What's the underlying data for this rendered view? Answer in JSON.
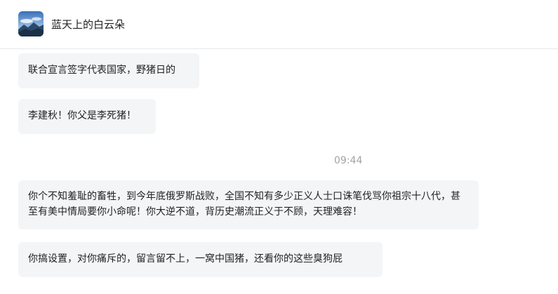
{
  "header": {
    "contact_name": "蓝天上的白云朵"
  },
  "messages": [
    {
      "text": "联合宣言签字代表国家，野猪日的"
    },
    {
      "text": "李建秋！你父是李死猪！"
    },
    {
      "text": "你个不知羞耻的畜牲，到今年底俄罗斯战败，全国不知有多少正义人士口诛笔伐骂你祖宗十八代，甚至有美中情局要你小命呢！你大逆不道，背历史潮流正义于不顾，天理难容！"
    },
    {
      "text": "你搞设置，对你痛斥的，留言留不上，一窝中国猪，还看你的这些臭狗屁"
    }
  ],
  "timestamp": "09:44"
}
